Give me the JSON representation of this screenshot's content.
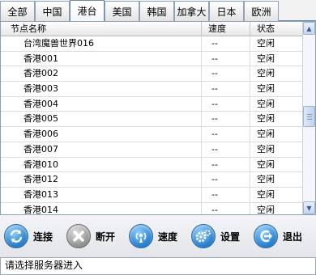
{
  "tabs": [
    "全部",
    "中国",
    "港台",
    "美国",
    "韩国",
    "加拿大",
    "日本",
    "欧洲"
  ],
  "active_tab_index": 2,
  "table": {
    "columns": [
      "节点名称",
      "速度",
      "状态"
    ],
    "rows": [
      [
        "台湾魔兽世界016",
        "--",
        "空闲"
      ],
      [
        "香港001",
        "--",
        "空闲"
      ],
      [
        "香港002",
        "--",
        "空闲"
      ],
      [
        "香港003",
        "--",
        "空闲"
      ],
      [
        "香港004",
        "--",
        "空闲"
      ],
      [
        "香港005",
        "--",
        "空闲"
      ],
      [
        "香港006",
        "--",
        "空闲"
      ],
      [
        "香港007",
        "--",
        "空闲"
      ],
      [
        "香港010",
        "--",
        "空闲"
      ],
      [
        "香港012",
        "--",
        "空闲"
      ],
      [
        "香港013",
        "--",
        "空闲"
      ],
      [
        "香港014",
        "--",
        "空闲"
      ]
    ]
  },
  "toolbar": {
    "connect": "连接",
    "disconnect": "断开",
    "speed": "速度",
    "settings": "设置",
    "exit": "退出"
  },
  "status_text": "请选择服务器进入",
  "icons": {
    "connect": "refresh-arrows-icon",
    "disconnect": "close-x-icon",
    "speed": "antenna-signal-icon",
    "settings": "gears-icon",
    "exit": "exit-arrow-icon"
  },
  "colors": {
    "accent": "#1e78c8",
    "disabled": "#8a8a8a"
  }
}
